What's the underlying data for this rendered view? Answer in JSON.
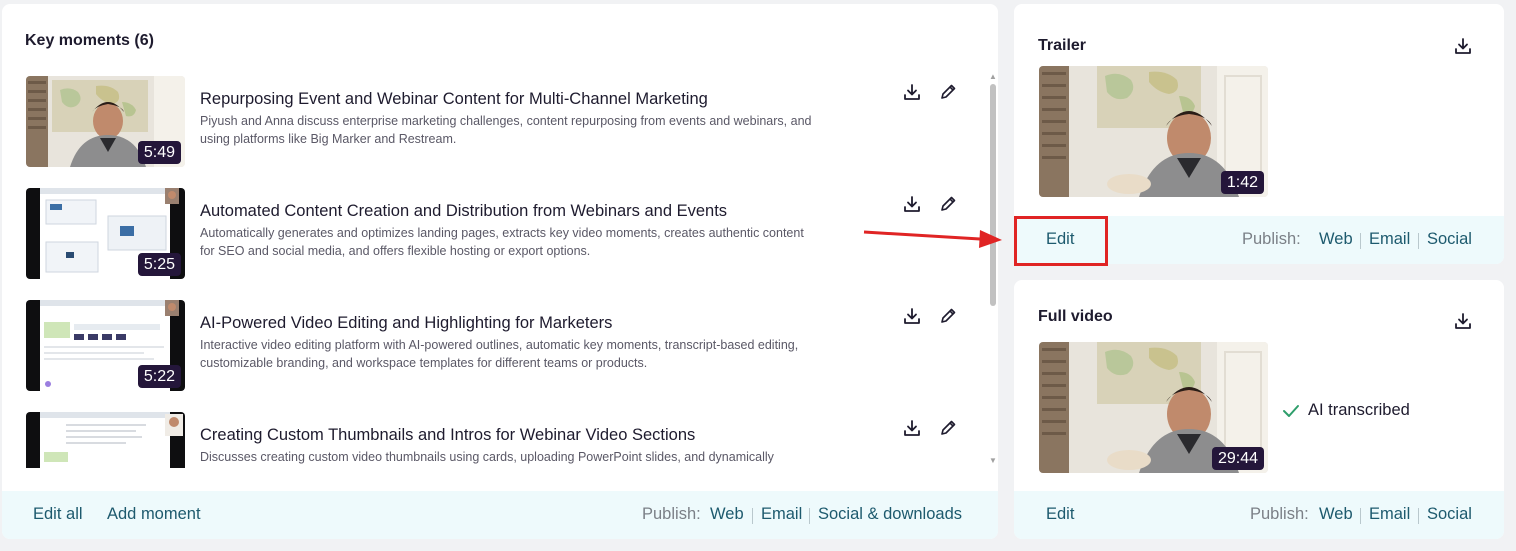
{
  "key_moments": {
    "title": "Key moments (6)",
    "items": [
      {
        "title": "Repurposing Event and Webinar Content for Multi-Channel Marketing",
        "description": "Piyush and Anna discuss enterprise marketing challenges, content repurposing from events and webinars, and using platforms like Big Marker and Restream.",
        "duration": "5:49"
      },
      {
        "title": "Automated Content Creation and Distribution from Webinars and Events",
        "description": "Automatically generates and optimizes landing pages, extracts key video moments, creates authentic content for SEO and social media, and offers flexible hosting or export options.",
        "duration": "5:25"
      },
      {
        "title": "AI-Powered Video Editing and Highlighting for Marketers",
        "description": "Interactive video editing platform with AI-powered outlines, automatic key moments, transcript-based editing, customizable branding, and workspace templates for different teams or products.",
        "duration": "5:22"
      },
      {
        "title": "Creating Custom Thumbnails and Intros for Webinar Video Sections",
        "description": "Discusses creating custom video thumbnails using cards, uploading PowerPoint slides, and dynamically applying styles for efficient workflows.",
        "duration": ""
      }
    ],
    "footer": {
      "edit_all": "Edit all",
      "add_moment": "Add moment",
      "publish_label": "Publish:",
      "web": "Web",
      "email": "Email",
      "social": "Social & downloads"
    }
  },
  "trailer": {
    "title": "Trailer",
    "duration": "1:42",
    "footer": {
      "edit": "Edit",
      "publish_label": "Publish:",
      "web": "Web",
      "email": "Email",
      "social": "Social"
    }
  },
  "full_video": {
    "title": "Full video",
    "duration": "29:44",
    "ai_status": "AI transcribed",
    "footer": {
      "edit": "Edit",
      "publish_label": "Publish:",
      "web": "Web",
      "email": "Email",
      "social": "Social"
    }
  },
  "colors": {
    "accent_link": "#1d5a6e",
    "footer_bg": "#eefafc",
    "duration_badge": "#24163a",
    "annotation_red": "#e02424",
    "check_green": "#2e9e6b"
  },
  "icons": [
    "download-icon",
    "pencil-icon",
    "check-icon",
    "arrow-annotation"
  ]
}
